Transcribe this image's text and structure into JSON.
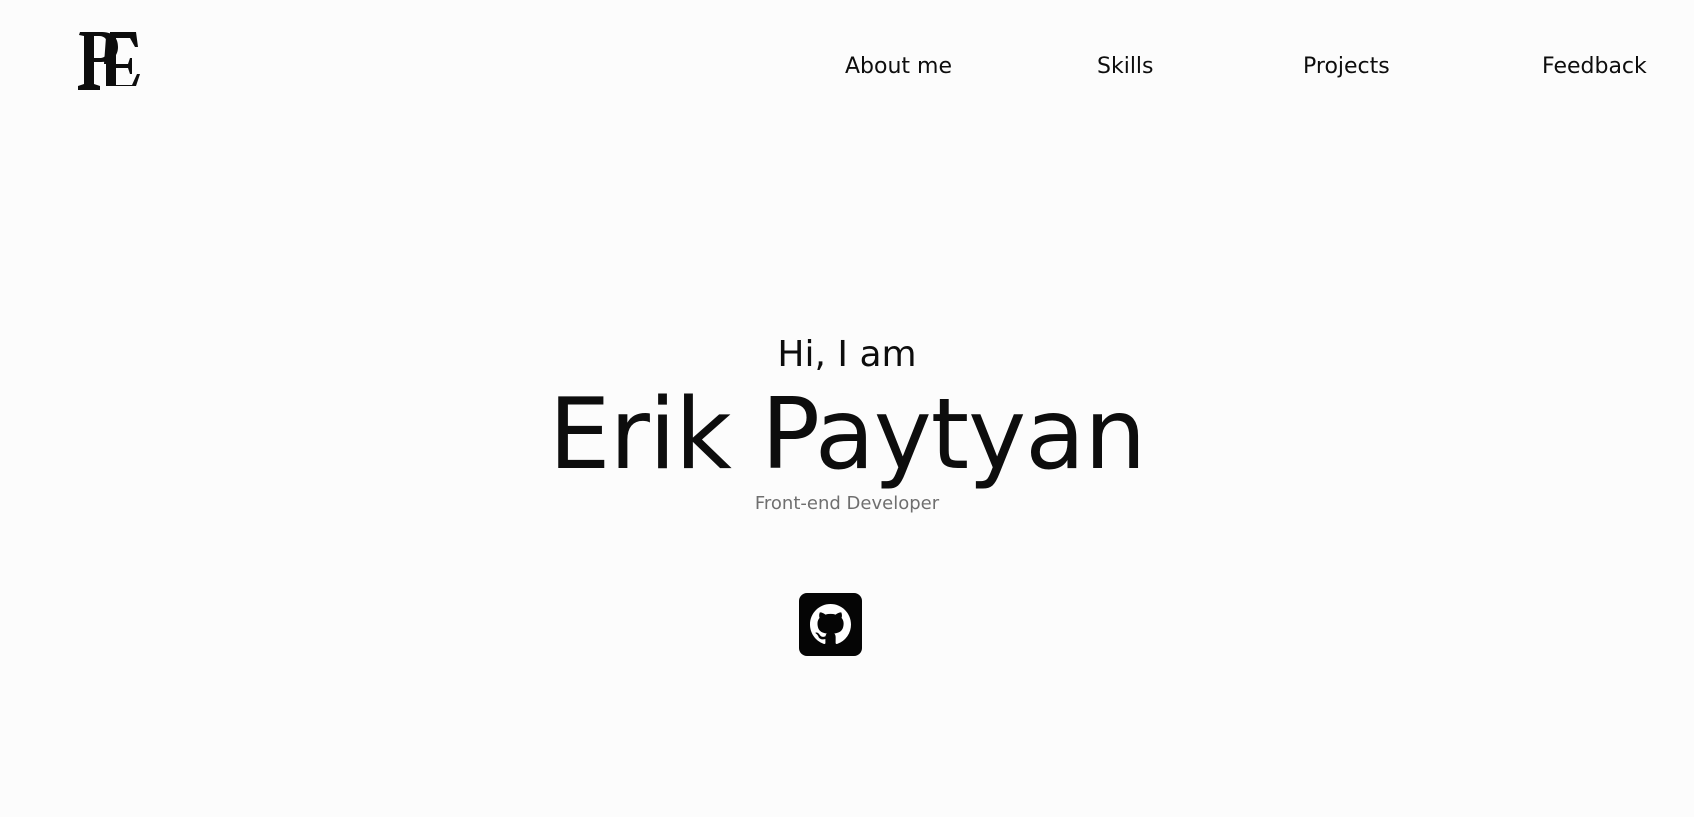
{
  "logo": {
    "icon": "pe-monogram-logo"
  },
  "nav": {
    "items": [
      {
        "label": "About me"
      },
      {
        "label": "Skills"
      },
      {
        "label": "Projects"
      },
      {
        "label": "Feedback"
      }
    ]
  },
  "hero": {
    "greeting": "Hi, I am",
    "name": "Erik Paytyan",
    "role": "Front-end Developer"
  },
  "social": {
    "github": {
      "icon": "github-icon"
    }
  },
  "colors": {
    "background": "#fcfcfc",
    "text": "#0d0d0d",
    "muted": "#6f6f6f",
    "icon_bg": "#050505"
  }
}
